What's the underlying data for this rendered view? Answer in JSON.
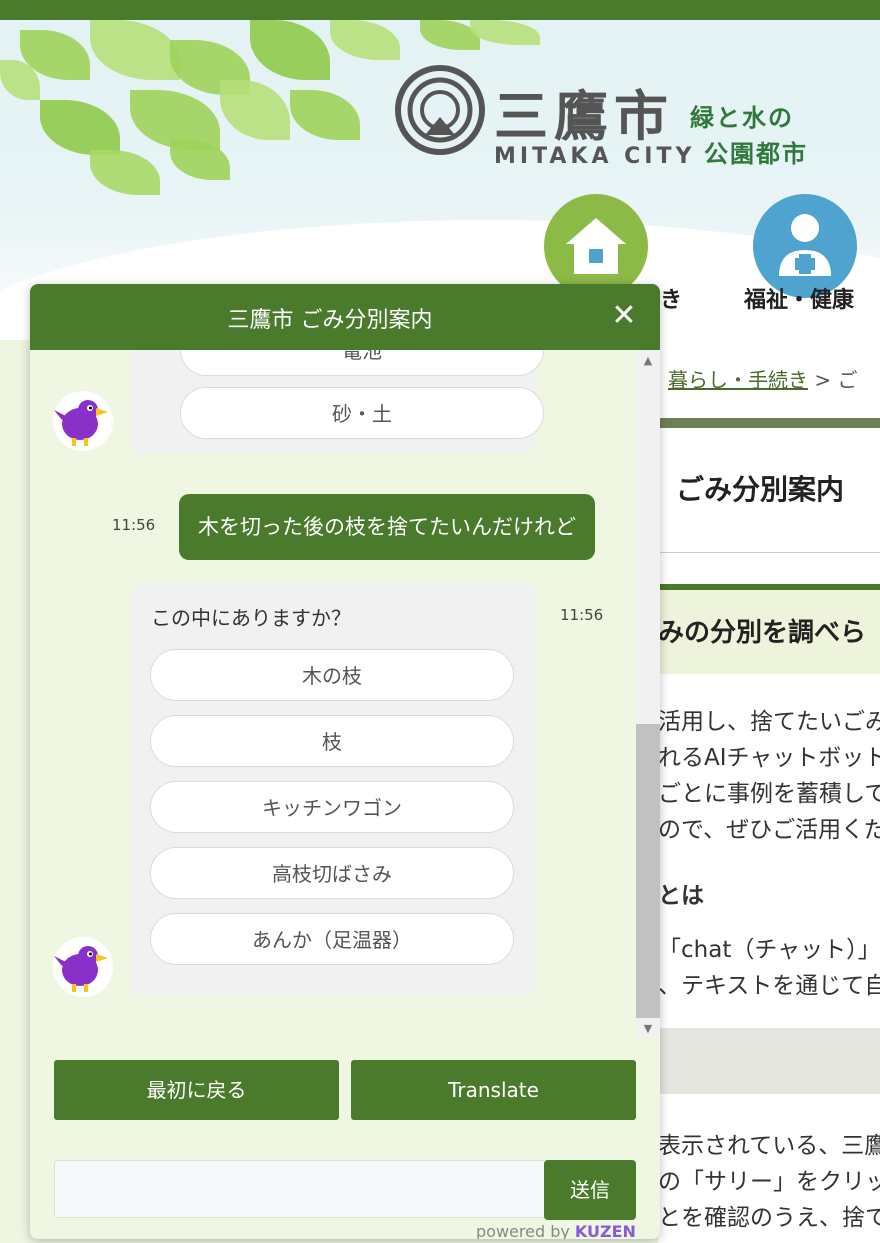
{
  "site": {
    "name_jp": "三鷹市",
    "name_en": "MITAKA CITY",
    "tagline_1": "緑と水の",
    "tagline_2": "公園都市",
    "nav": [
      {
        "label": "き"
      },
      {
        "label": "福祉・健康"
      }
    ]
  },
  "content": {
    "breadcrumb_link": "暮らし・手続き",
    "breadcrumb_rest": " > ご",
    "title": "ごみ分別案内",
    "section_heading": "みの分別を調べら",
    "paragraph_lines": [
      "活用し、捨てたいごみ",
      "れるAIチャットボット",
      "ごとに事例を蓄積して",
      "ので、ぜひご活用くだ"
    ],
    "subheading": "とは",
    "paragraph2_lines": [
      "「chat（チャット）」",
      "、テキストを通じて自"
    ],
    "paragraph3_lines": [
      "表示されている、三鷹",
      "の「サリー」をクリッ",
      "とを確認のうえ、捨て"
    ]
  },
  "chat": {
    "title": "三鷹市 ごみ分別案内",
    "close_label": "✕",
    "prev_options": [
      "電池",
      "砂・土"
    ],
    "user_message": "木を切った後の枝を捨てたいんだけれど",
    "user_time": "11:56",
    "bot_question": "この中にありますか？",
    "bot_time": "11:56",
    "options": [
      "木の枝",
      "枝",
      "キッチンワゴン",
      "高枝切ばさみ",
      "あんか（足温器）"
    ],
    "btn_restart": "最初に戻る",
    "btn_translate": "Translate",
    "input_value": "",
    "send_label": "送信",
    "powered_by": "powered by",
    "powered_brand": "KUZEN"
  },
  "colors": {
    "brand_green": "#4a7a2c",
    "chat_bg": "#eff7e2",
    "kuzen_purple": "#8a5ad6"
  },
  "icons": [
    "mitaka-logo-icon",
    "house-icon",
    "welfare-person-icon",
    "close-icon",
    "mascot-bird-icon"
  ]
}
